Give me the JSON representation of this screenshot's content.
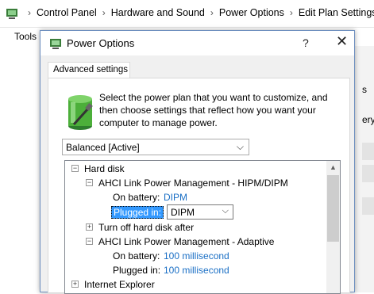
{
  "control_panel": {
    "breadcrumb": [
      "Control Panel",
      "Hardware and Sound",
      "Power Options",
      "Edit Plan Settings"
    ],
    "menu": {
      "tools": "Tools"
    },
    "right_edge_fragments": [
      "s",
      "ery"
    ]
  },
  "dialog": {
    "title": "Power Options",
    "help_label": "?",
    "close_label": "✕",
    "tab_label": "Advanced settings",
    "description": "Select the power plan that you want to customize, and then choose settings that reflect how you want your computer to manage power.",
    "plan_select_value": "Balanced [Active]",
    "tree": {
      "hard_disk": {
        "label": "Hard disk",
        "expander": "−"
      },
      "ahci_hipm": {
        "label": "AHCI Link Power Management - HIPM/DIPM",
        "expander": "−"
      },
      "on_battery_1": {
        "label": "On battery:",
        "value": "DIPM"
      },
      "plugged_in_1": {
        "label": "Plugged in:",
        "value": "DIPM"
      },
      "turn_off": {
        "label": "Turn off hard disk after",
        "expander": "+"
      },
      "ahci_adaptive": {
        "label": "AHCI Link Power Management - Adaptive",
        "expander": "−"
      },
      "on_battery_2": {
        "label": "On battery:",
        "value": "100 millisecond"
      },
      "plugged_in_2": {
        "label": "Plugged in:",
        "value": "100 millisecond"
      },
      "internet_explorer": {
        "label": "Internet Explorer",
        "expander": "+"
      }
    }
  },
  "colors": {
    "accent_link": "#1a6fc5",
    "selection": "#3399ff"
  }
}
